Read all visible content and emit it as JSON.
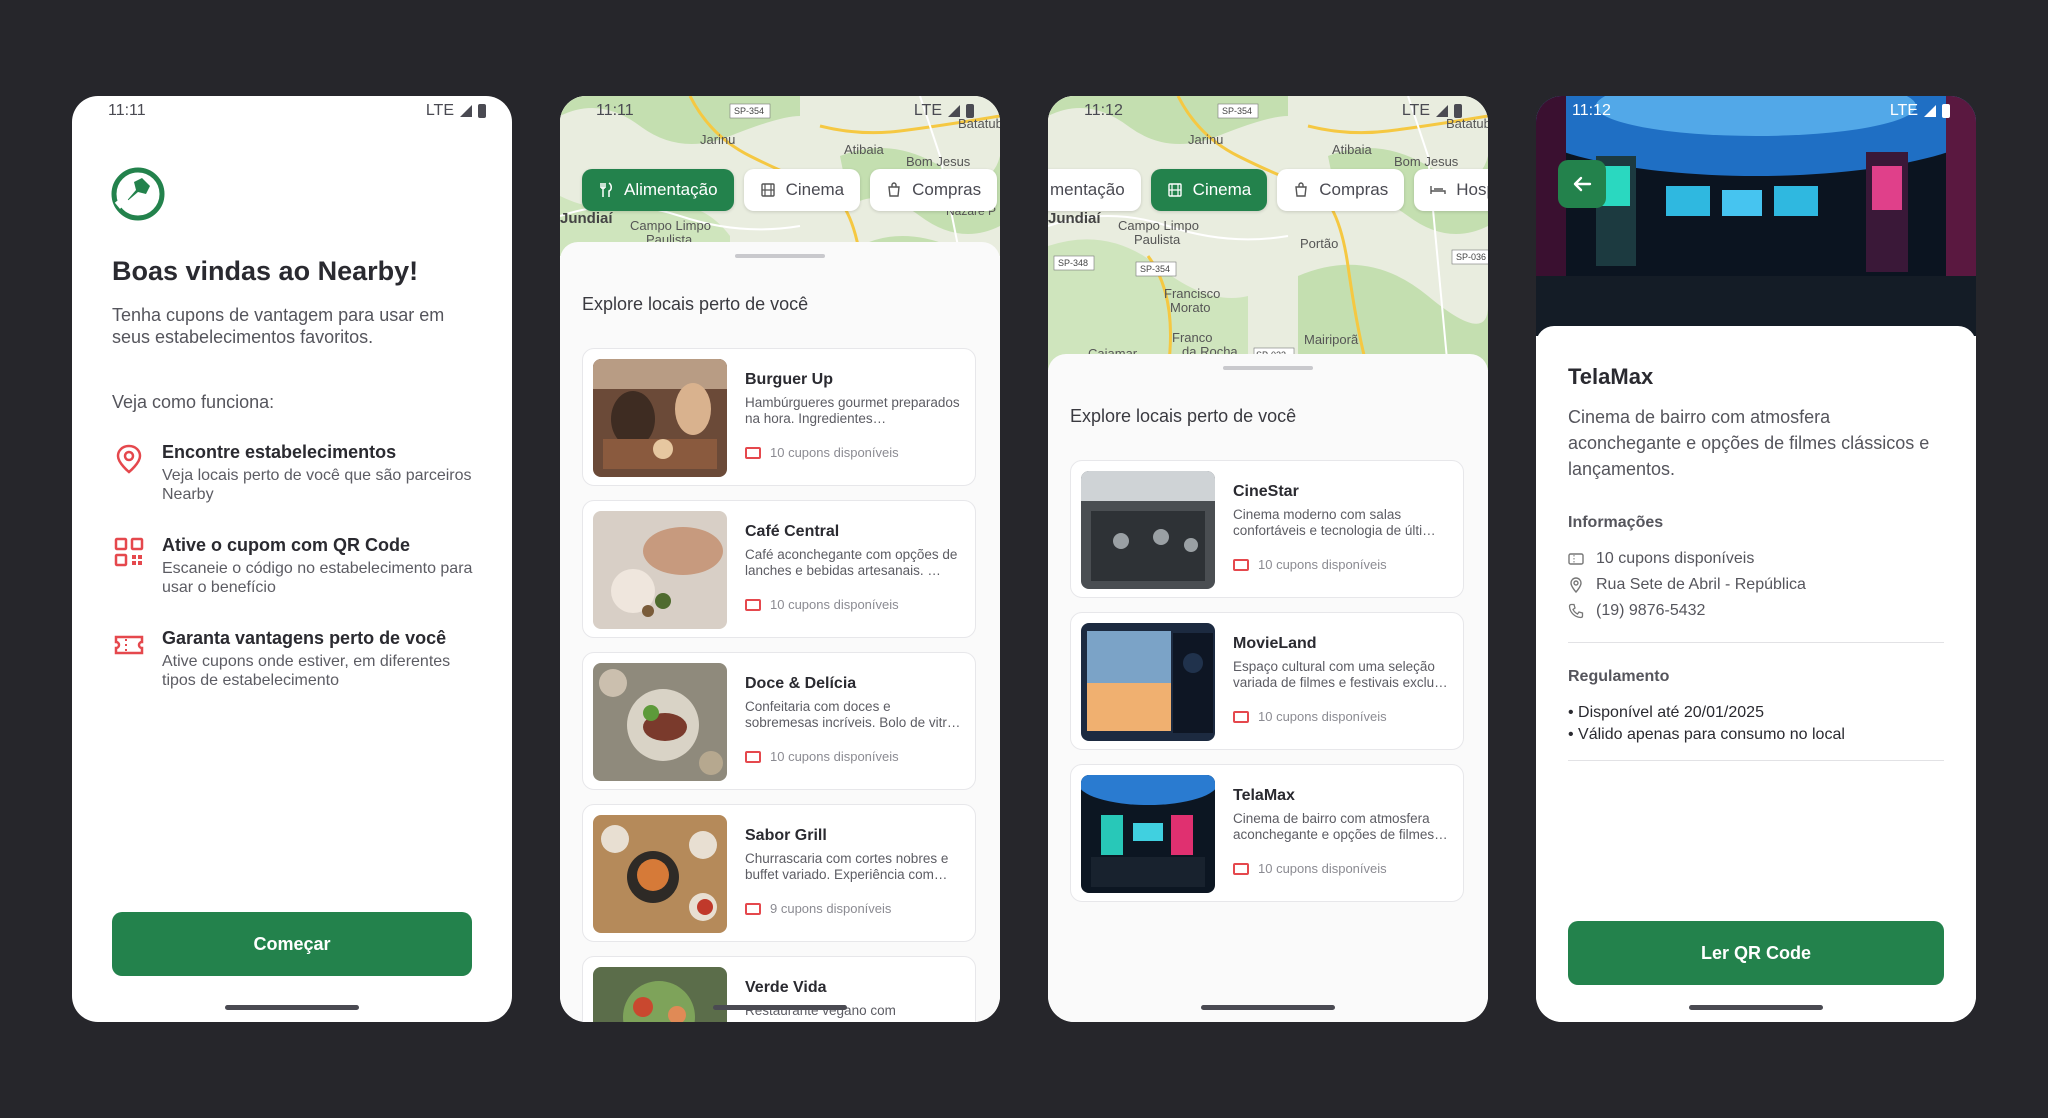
{
  "colors": {
    "primary": "#23824c",
    "accent": "#e5484d",
    "background": "#26262b"
  },
  "screen1": {
    "time": "11:11",
    "network": "LTE",
    "title": "Boas vindas ao Nearby!",
    "subtitle": "Tenha cupons de vantagem para usar em seus estabelecimentos favoritos.",
    "how_it_works": "Veja como funciona:",
    "steps": [
      {
        "icon": "map-pin-icon",
        "title": "Encontre estabelecimentos",
        "desc": "Veja locais perto de você que são parceiros Nearby"
      },
      {
        "icon": "qrcode-icon",
        "title": "Ative o cupom com QR Code",
        "desc": "Escaneie o código no estabelecimento para usar o benefício"
      },
      {
        "icon": "ticket-icon",
        "title": "Garanta vantagens perto de você",
        "desc": "Ative cupons onde estiver, em diferentes tipos de estabelecimento"
      }
    ],
    "start_button": "Começar"
  },
  "screen2": {
    "time": "11:11",
    "network": "LTE",
    "map_labels": {
      "jarinu": "Jarinu",
      "atibaia": "Atibaia",
      "bom_jesus": "Bom Jesus",
      "batatuba": "Batatub",
      "jundiai": "Jundiaí",
      "campo_limpo": "Campo Limpo",
      "paulista": "Paulista",
      "nazare": "Nazaré P",
      "sp354": "SP-354"
    },
    "categories": [
      {
        "label": "Alimentação",
        "icon": "fork-knife-icon",
        "active": true
      },
      {
        "label": "Cinema",
        "icon": "film-icon",
        "active": false
      },
      {
        "label": "Compras",
        "icon": "shopping-bag-icon",
        "active": false
      }
    ],
    "section_title": "Explore locais perto de você",
    "places": [
      {
        "name": "Burguer Up",
        "desc": "Hambúrgueres gourmet preparados na hora. Ingredientes…",
        "coupons": "10 cupons disponíveis"
      },
      {
        "name": "Café Central",
        "desc": "Café aconchegante com opções de lanches e bebidas artesanais. …",
        "coupons": "10 cupons disponíveis"
      },
      {
        "name": "Doce & Delícia",
        "desc": "Confeitaria com doces e sobremesas incríveis. Bolo de vitr…",
        "coupons": "10 cupons disponíveis"
      },
      {
        "name": "Sabor Grill",
        "desc": "Churrascaria com cortes nobres e buffet variado. Experiência com…",
        "coupons": "9 cupons disponíveis"
      },
      {
        "name": "Verde Vida",
        "desc": "Restaurante vegano com",
        "coupons": ""
      }
    ]
  },
  "screen3": {
    "time": "11:12",
    "network": "LTE",
    "map_labels": {
      "jarinu": "Jarinu",
      "atibaia": "Atibaia",
      "bom_jesus": "Bom Jesus",
      "batatuba": "Batatub",
      "jundiai": "Jundiaí",
      "campo_limpo": "Campo Limpo",
      "paulista": "Paulista",
      "portao": "Portão",
      "francisco": "Francisco",
      "morato": "Morato",
      "franco": "Franco",
      "da_rocha": "da Rocha",
      "mairipora": "Mairiporã",
      "caiamar": "Caiamar",
      "sp354": "SP-354",
      "sp348": "SP-348",
      "sp354b": "SP-354",
      "sp023": "SP-023",
      "sp036": "SP-036"
    },
    "categories": [
      {
        "label": "mentação",
        "icon": "",
        "active": false
      },
      {
        "label": "Cinema",
        "icon": "film-icon",
        "active": true
      },
      {
        "label": "Compras",
        "icon": "shopping-bag-icon",
        "active": false
      },
      {
        "label": "Hosp",
        "icon": "bed-icon",
        "active": false
      }
    ],
    "section_title": "Explore locais perto de você",
    "places": [
      {
        "name": "CineStar",
        "desc": "Cinema moderno com salas confortáveis e tecnologia de últi…",
        "coupons": "10 cupons disponíveis"
      },
      {
        "name": "MovieLand",
        "desc": "Espaço cultural com uma seleção variada de filmes e festivais exclu…",
        "coupons": "10 cupons disponíveis"
      },
      {
        "name": "TelaMax",
        "desc": "Cinema de bairro com atmosfera aconchegante e opções de filmes…",
        "coupons": "10 cupons disponíveis"
      }
    ]
  },
  "screen4": {
    "time": "11:12",
    "network": "LTE",
    "name": "TelaMax",
    "description": "Cinema de bairro com atmosfera aconchegante e opções de filmes clássicos e lançamentos.",
    "info_title": "Informações",
    "info": {
      "coupons": "10 cupons disponíveis",
      "address": "Rua Sete de Abril - República",
      "phone": "(19) 9876-5432"
    },
    "rules_title": "Regulamento",
    "rules": [
      "• Disponível até 20/01/2025",
      "• Válido apenas para consumo no local"
    ],
    "qr_button": "Ler QR Code"
  }
}
